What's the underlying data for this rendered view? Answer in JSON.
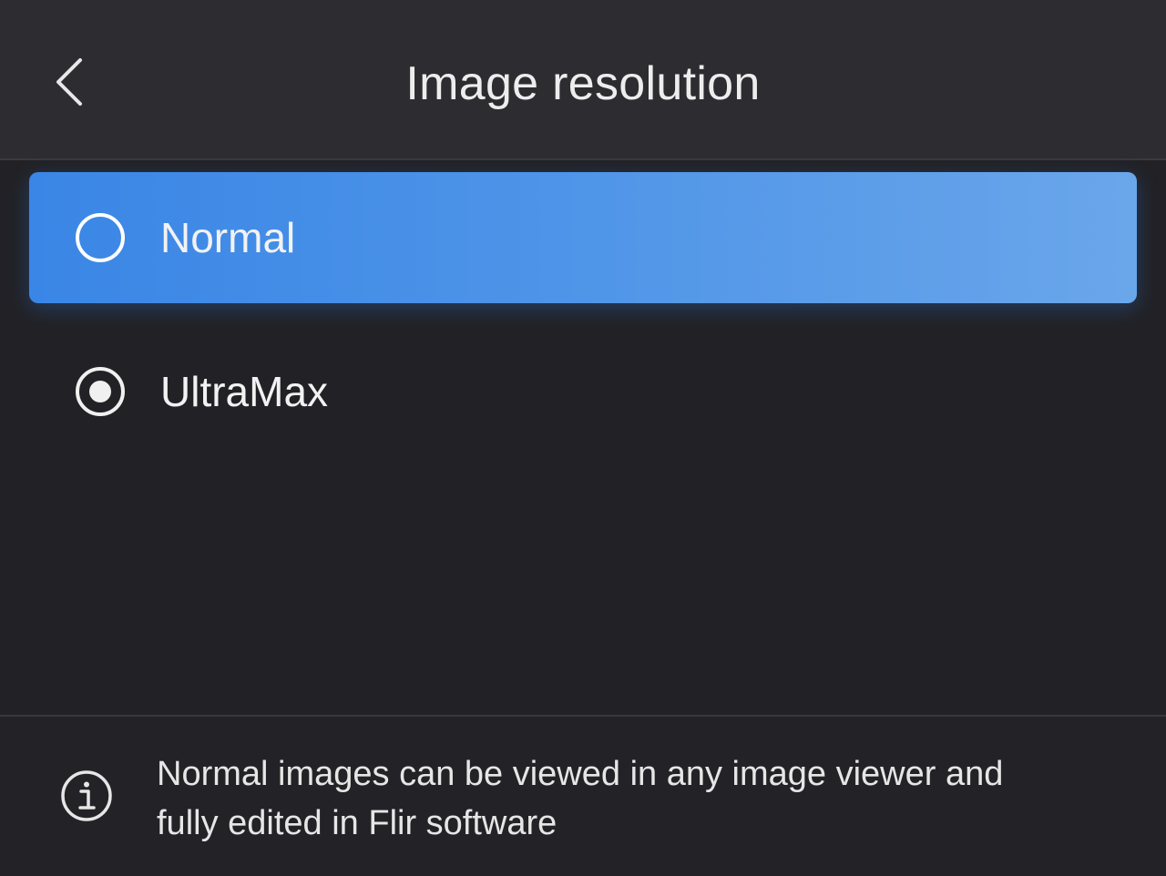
{
  "header": {
    "title": "Image resolution",
    "back_icon": "chevron-left-icon"
  },
  "options": [
    {
      "label": "Normal",
      "selected": false,
      "highlighted": true
    },
    {
      "label": "UltraMax",
      "selected": true,
      "highlighted": false
    }
  ],
  "info": {
    "icon": "info-icon",
    "text_line1": "Normal images can be viewed in any image viewer and",
    "text_line2": "fully edited in Flir software"
  },
  "colors": {
    "background": "#222226",
    "header": "#2d2d31",
    "highlight": "#3a86e6",
    "text": "#ececec"
  }
}
